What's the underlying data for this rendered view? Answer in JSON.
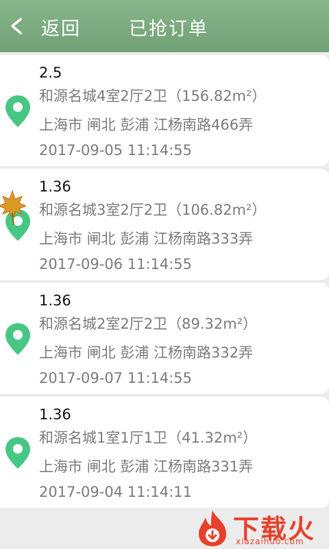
{
  "header": {
    "back_label": "返回",
    "title": "已抢订单",
    "background_color": "#7aab7d"
  },
  "orders": [
    {
      "price": "2.5",
      "property": "和源名城4室2厅2卫（156.82m²）",
      "address": "上海市 闸北 彭浦 江杨南路466弄",
      "time": "2017-09-05 11:14:55"
    },
    {
      "price": "1.36",
      "property": "和源名城3室2厅2卫（106.82m²）",
      "address": "上海市 闸北 彭浦 江杨南路333弄",
      "time": "2017-09-06 11:14:55"
    },
    {
      "price": "1.36",
      "property": "和源名城2室2厅2卫（89.32m²）",
      "address": "上海市 闸北 彭浦 江杨南路332弄",
      "time": "2017-09-07 11:14:55"
    },
    {
      "price": "1.36",
      "property": "和源名城1室1厅1卫（41.32m²）",
      "address": "上海市 闸北 彭浦 江杨南路331弄",
      "time": "2017-09-04 11:14:11"
    }
  ],
  "icons": {
    "back": "chevron-left-icon",
    "location": "map-pin-icon",
    "decoration": "maple-leaf-icon"
  },
  "colors": {
    "pin": "#46c783",
    "card": "#ffffff",
    "background": "#ececec",
    "watermark": "#e7412c"
  },
  "watermark": {
    "text": "下载火",
    "url": "xiazaihuo.com"
  }
}
